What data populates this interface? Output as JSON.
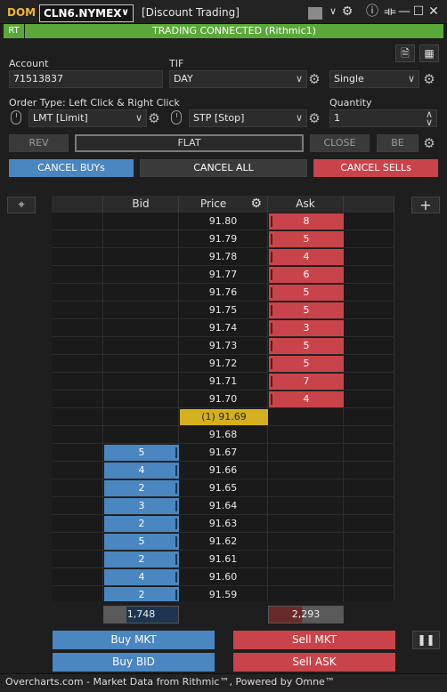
{
  "title_bar": {
    "dom_label": "DOM",
    "symbol": "CLN6.NYMEX",
    "account_name": "[Discount Trading]"
  },
  "status": {
    "rt": "RT",
    "text": "TRADING CONNECTED  (Rithmic1)"
  },
  "account": {
    "label": "Account",
    "value": "71513837"
  },
  "tif": {
    "label": "TIF",
    "value": "DAY"
  },
  "mode": {
    "value": "Single"
  },
  "order_type": {
    "label": "Order Type: Left Click & Right Click",
    "left_value": "LMT [Limit]",
    "right_value": "STP [Stop]"
  },
  "quantity": {
    "label": "Quantity",
    "value": "1"
  },
  "buttons": {
    "rev": "REV",
    "flat": "FLAT",
    "close": "CLOSE",
    "be": "BE",
    "cancel_buys": "CANCEL BUYs",
    "cancel_all": "CANCEL ALL",
    "cancel_sells": "CANCEL SELLs",
    "buy_mkt": "Buy MKT",
    "sell_mkt": "Sell MKT",
    "buy_bid": "Buy BID",
    "sell_ask": "Sell ASK"
  },
  "ladder": {
    "headers": {
      "bid": "Bid",
      "price": "Price",
      "ask": "Ask"
    },
    "rows": [
      {
        "price": "91.80",
        "ask": "8",
        "bid": ""
      },
      {
        "price": "91.79",
        "ask": "5",
        "bid": ""
      },
      {
        "price": "91.78",
        "ask": "4",
        "bid": ""
      },
      {
        "price": "91.77",
        "ask": "6",
        "bid": ""
      },
      {
        "price": "91.76",
        "ask": "5",
        "bid": ""
      },
      {
        "price": "91.75",
        "ask": "5",
        "bid": ""
      },
      {
        "price": "91.74",
        "ask": "3",
        "bid": ""
      },
      {
        "price": "91.73",
        "ask": "5",
        "bid": ""
      },
      {
        "price": "91.72",
        "ask": "5",
        "bid": ""
      },
      {
        "price": "91.71",
        "ask": "7",
        "bid": ""
      },
      {
        "price": "91.70",
        "ask": "4",
        "bid": ""
      },
      {
        "price": "(1)  91.69",
        "ask": "",
        "bid": "",
        "last": true
      },
      {
        "price": "91.68",
        "ask": "",
        "bid": ""
      },
      {
        "price": "91.67",
        "ask": "",
        "bid": "5"
      },
      {
        "price": "91.66",
        "ask": "",
        "bid": "4"
      },
      {
        "price": "91.65",
        "ask": "",
        "bid": "2"
      },
      {
        "price": "91.64",
        "ask": "",
        "bid": "3"
      },
      {
        "price": "91.63",
        "ask": "",
        "bid": "2"
      },
      {
        "price": "91.62",
        "ask": "",
        "bid": "5"
      },
      {
        "price": "91.61",
        "ask": "",
        "bid": "2"
      },
      {
        "price": "91.60",
        "ask": "",
        "bid": "4"
      },
      {
        "price": "91.59",
        "ask": "",
        "bid": "2"
      }
    ],
    "bid_total": "1,748",
    "ask_total": "2,293"
  },
  "colors": {
    "bid": "#4a86c0",
    "ask": "#c9444a",
    "last_price": "#d4b01f",
    "connected": "#5aa83a",
    "accent": "#f2b53c"
  },
  "footer": {
    "text": "Overcharts.com - Market Data from Rithmic™, Powered by Omne™"
  }
}
